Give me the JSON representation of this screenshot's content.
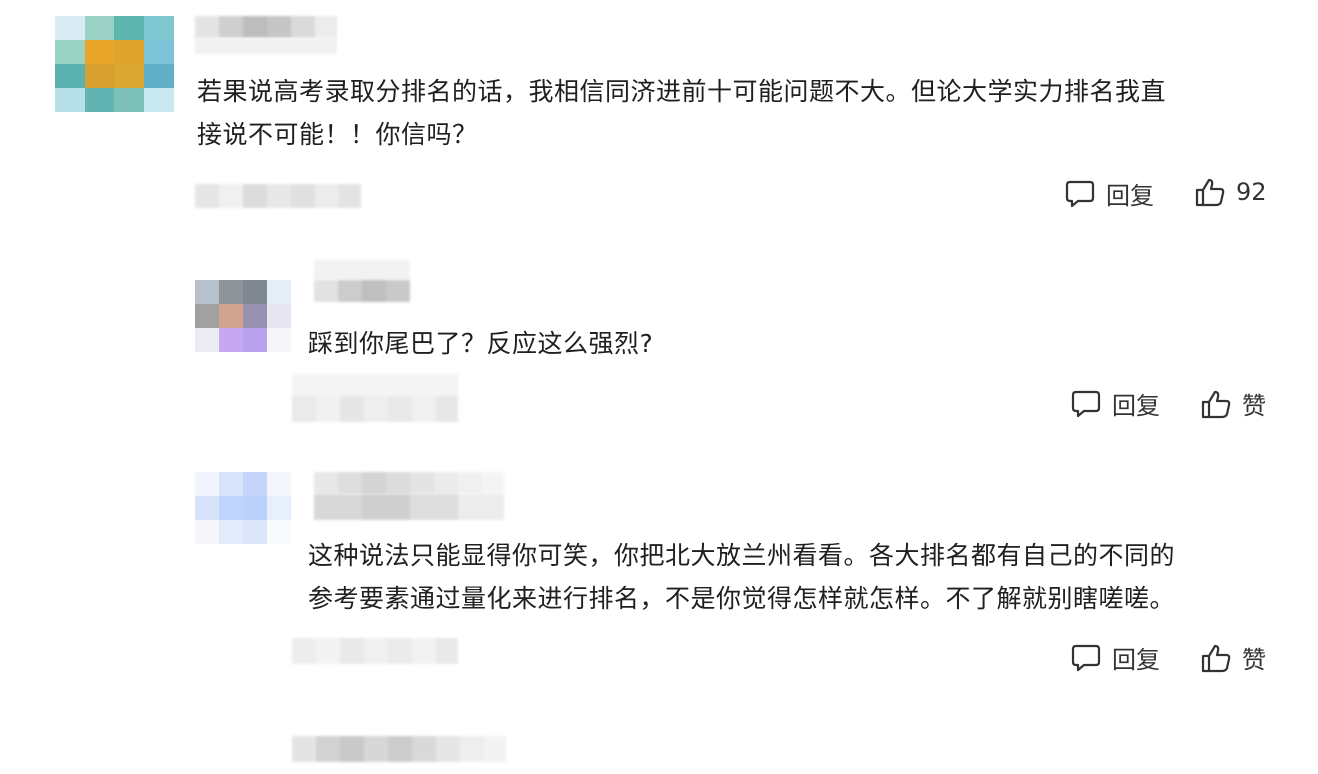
{
  "comments": [
    {
      "text": "若果说高考录取分排名的话，我相信同济进前十可能问题不大。但论大学实力排名我直\n接说不可能！！你信吗？",
      "reply_label": "回复",
      "like_label": "92",
      "avatar_colors": [
        "#d9ecf3",
        "#9bd0c4",
        "#5cb6ae",
        "#7fc7d0",
        "#9ad3c3",
        "#e8a62a",
        "#e0a42c",
        "#7cc3d7",
        "#5ab1ae",
        "#d79f30",
        "#dca832",
        "#5fb0c8",
        "#b8e0ea",
        "#62b4b3",
        "#7cc0ba",
        "#c9e9f1"
      ]
    },
    {
      "text": "踩到你尾巴了？反应这么强烈?",
      "reply_label": "回复",
      "like_label": "赞",
      "avatar_colors": [
        "#b6c1cc",
        "#8f949b",
        "#7f8792",
        "#e5eef7",
        "#a3a0a0",
        "#cfa590",
        "#9891b1",
        "#e8e6f1",
        "#eceaf2",
        "#c5a8ef",
        "#b9a1ef",
        "#f6f6f8"
      ]
    },
    {
      "text": "这种说法只能显得你可笑，你把北大放兰州看看。各大排名都有自己的不同的\n参考要素通过量化来进行排名，不是你觉得怎样就怎样。不了解就别瞎嗟嗟。",
      "reply_label": "回复",
      "like_label": "赞",
      "avatar_colors": [
        "#f1f5fd",
        "#d9e4fb",
        "#c5d6fa",
        "#f3f6fd",
        "#d6e3fb",
        "#c0d4fb",
        "#bbd0fa",
        "#e8effc",
        "#f5f7fd",
        "#e4ebfb",
        "#dce6fb",
        "#f8f9fd"
      ]
    }
  ]
}
